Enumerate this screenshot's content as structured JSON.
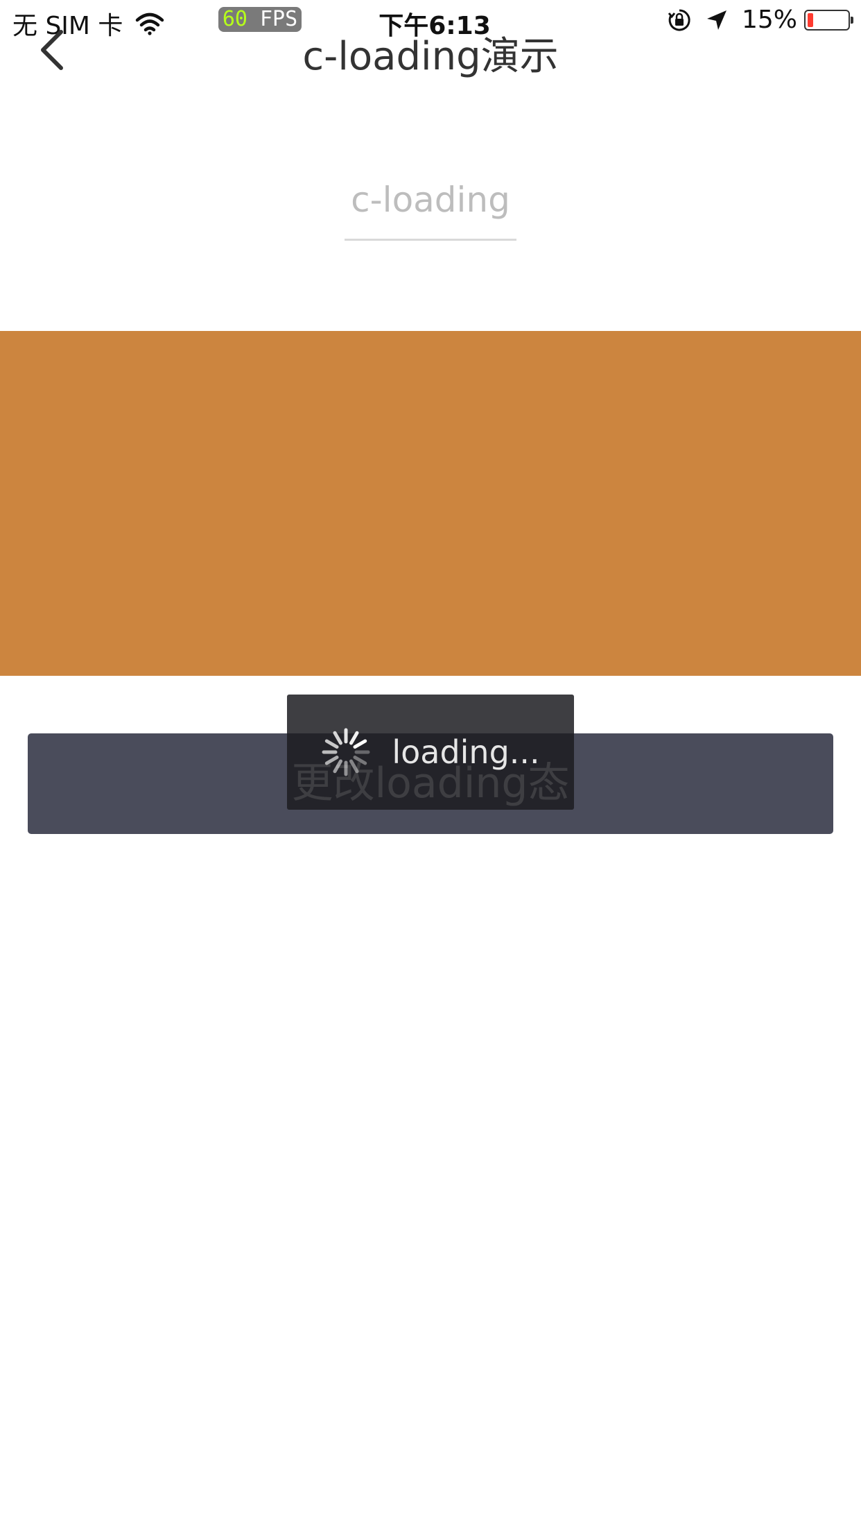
{
  "status_bar": {
    "carrier": "无 SIM 卡",
    "fps_value": "60",
    "fps_label": "FPS",
    "time": "下午6:13",
    "battery_percent": "15%",
    "battery_level": 0.15,
    "battery_color": "#ff3b30",
    "icons": [
      "wifi-icon",
      "orientation-lock-icon",
      "location-arrow-icon",
      "battery-icon"
    ]
  },
  "nav": {
    "title": "c-loading演示",
    "back_icon": "chevron-left-icon"
  },
  "input": {
    "value": "",
    "placeholder": "c-loading"
  },
  "block": {
    "color": "#cc853f"
  },
  "button": {
    "label": "更改loading态",
    "color": "#4a4c5b"
  },
  "loading": {
    "text": "loading...",
    "icon": "spinner-icon"
  }
}
